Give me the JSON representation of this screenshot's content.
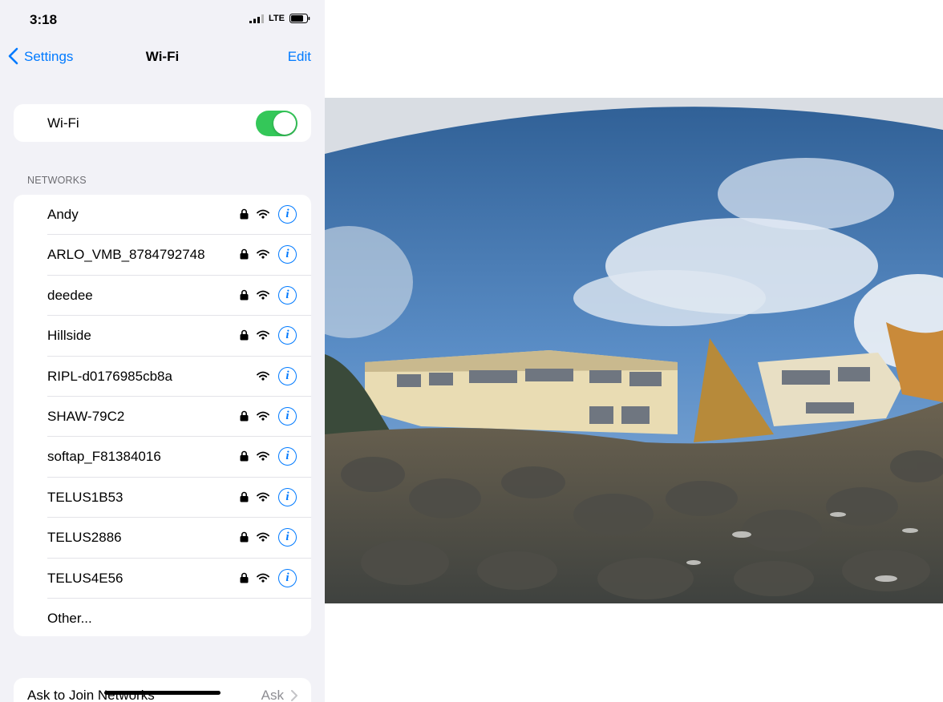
{
  "status_bar": {
    "time": "3:18",
    "network": "LTE"
  },
  "nav": {
    "back_label": "Settings",
    "title": "Wi-Fi",
    "edit_label": "Edit"
  },
  "wifi": {
    "label": "Wi-Fi",
    "enabled": true
  },
  "networks": {
    "header": "NETWORKS",
    "items": [
      {
        "name": "Andy",
        "locked": true
      },
      {
        "name": "ARLO_VMB_8784792748",
        "locked": true
      },
      {
        "name": "deedee",
        "locked": true
      },
      {
        "name": "Hillside",
        "locked": true
      },
      {
        "name": "RIPL-d0176985cb8a",
        "locked": false
      },
      {
        "name": "SHAW-79C2",
        "locked": true
      },
      {
        "name": "softap_F81384016",
        "locked": true
      },
      {
        "name": "TELUS1B53",
        "locked": true
      },
      {
        "name": "TELUS2886",
        "locked": true
      },
      {
        "name": "TELUS4E56",
        "locked": true
      }
    ],
    "other_label": "Other..."
  },
  "ask_to_join": {
    "label": "Ask to Join Networks",
    "value": "Ask"
  },
  "colors": {
    "accent": "#007aff",
    "toggle_on": "#34c759",
    "background": "#f2f2f7"
  }
}
